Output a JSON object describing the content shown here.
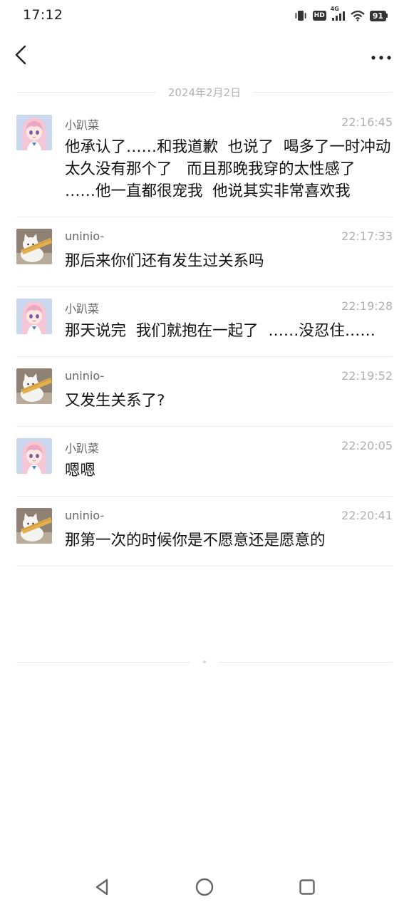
{
  "status_bar": {
    "time": "17:12",
    "network": "4G",
    "hd_label": "HD",
    "battery": "91"
  },
  "header": {
    "back_icon": "chevron-left-icon",
    "more_icon": "more-horizontal-icon"
  },
  "date_divider": "2024年2月2日",
  "colors": {
    "text": "#111111",
    "sender": "#666666",
    "timestamp": "#b0b0b0",
    "divider": "#ececec"
  },
  "messages": [
    {
      "sender": "小趴菜",
      "avatar": "anime-girl-avatar",
      "time": "22:16:45",
      "text": "他承认了……和我道歉  也说了  喝多了一时冲动   太久没有那个了   而且那晚我穿的太性感了  ……他一直都很宠我  他说其实非常喜欢我"
    },
    {
      "sender": "uninio-",
      "avatar": "white-cat-avatar",
      "time": "22:17:33",
      "text": "那后来你们还有发生过关系吗"
    },
    {
      "sender": "小趴菜",
      "avatar": "anime-girl-avatar",
      "time": "22:19:28",
      "text": "那天说完  我们就抱在一起了  ……没忍住……"
    },
    {
      "sender": "uninio-",
      "avatar": "white-cat-avatar",
      "time": "22:19:52",
      "text": "又发生关系了?"
    },
    {
      "sender": "小趴菜",
      "avatar": "anime-girl-avatar",
      "time": "22:20:05",
      "text": "嗯嗯"
    },
    {
      "sender": "uninio-",
      "avatar": "white-cat-avatar",
      "time": "22:20:41",
      "text": "那第一次的时候你是不愿意还是愿意的"
    }
  ],
  "nav_bar": {
    "back_icon": "triangle-back-icon",
    "home_icon": "circle-home-icon",
    "recents_icon": "square-recents-icon"
  }
}
